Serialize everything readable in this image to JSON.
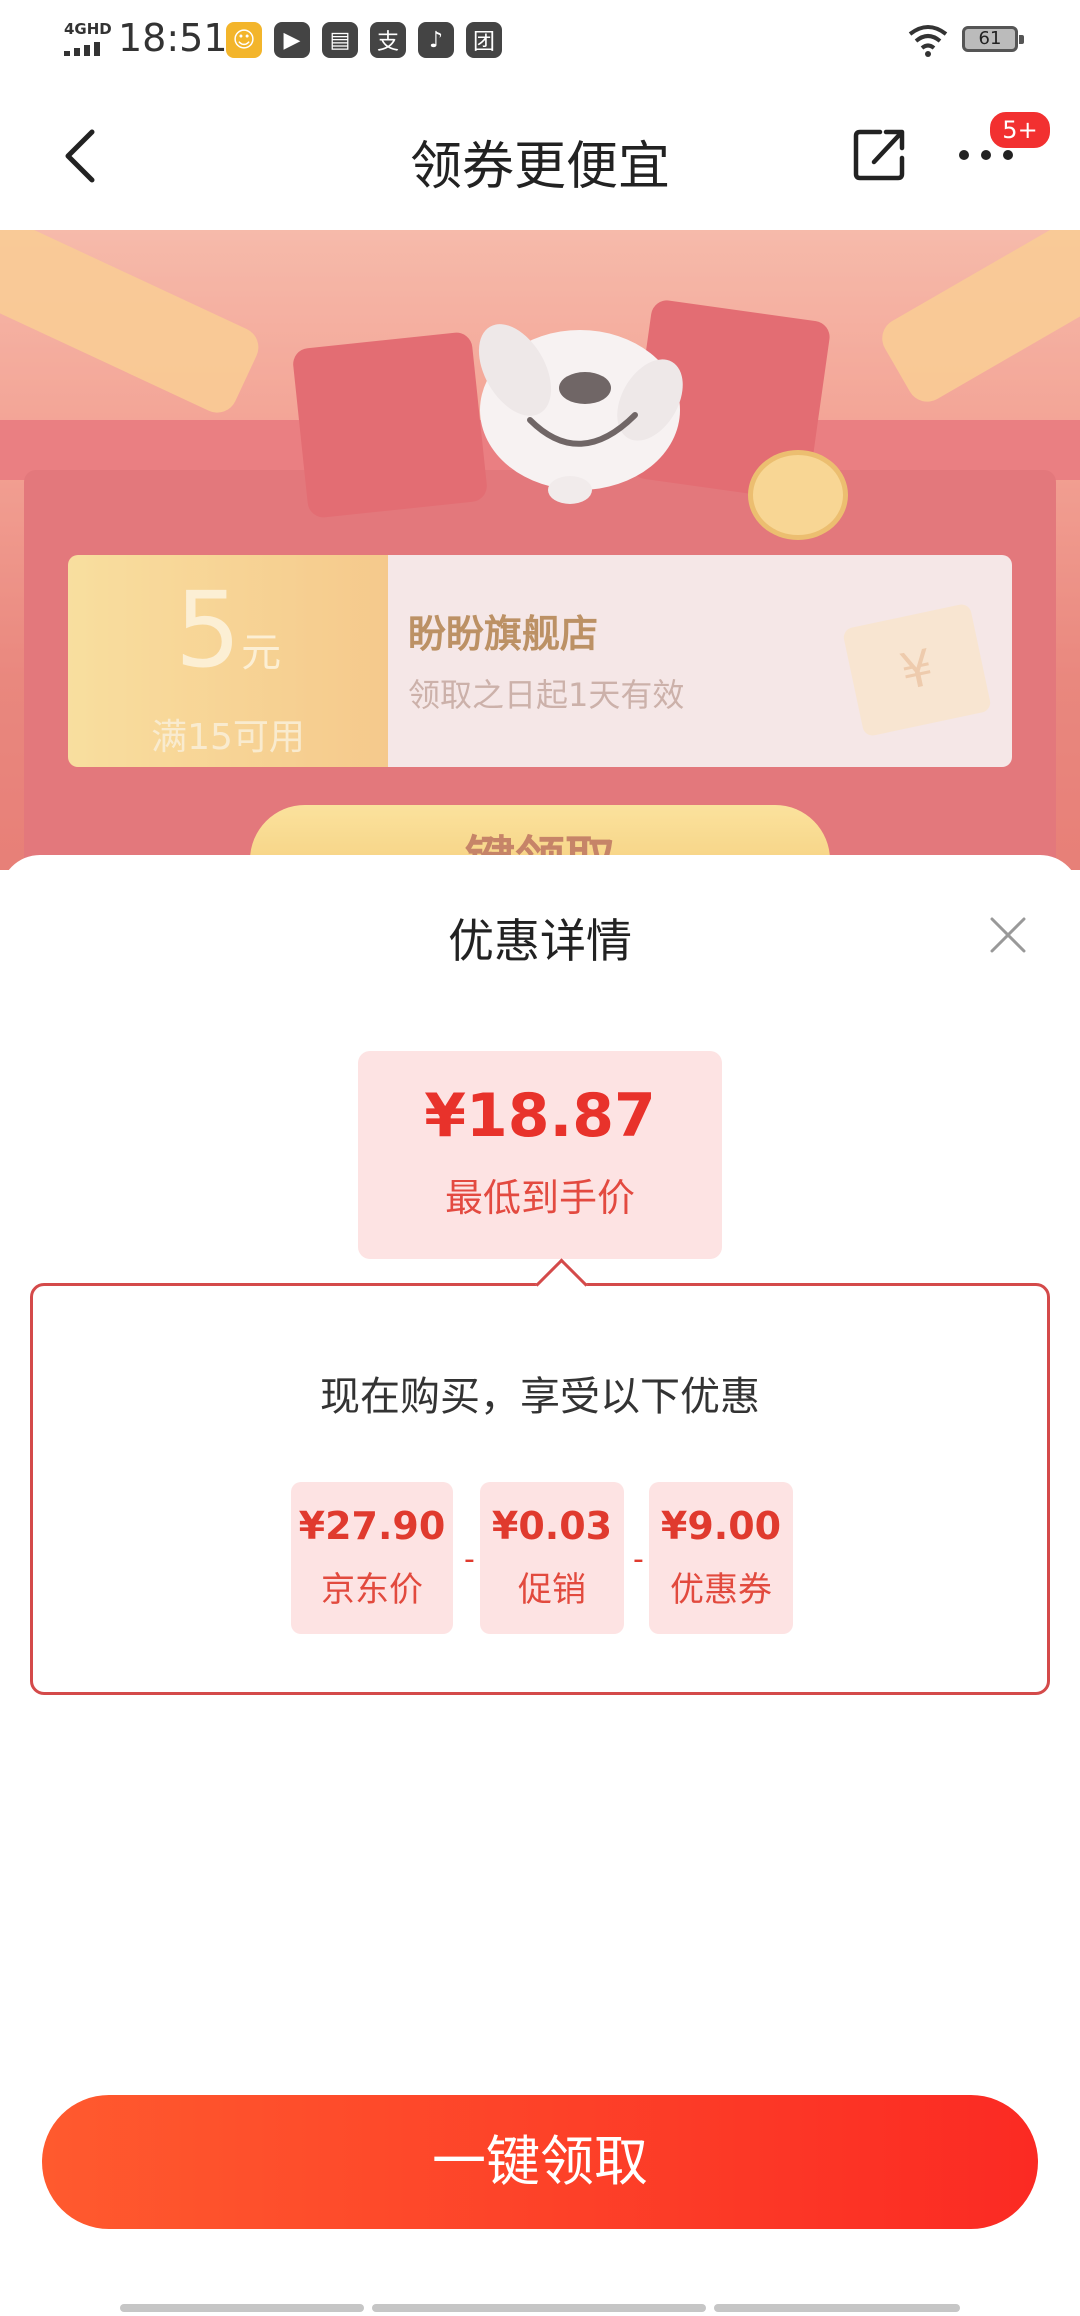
{
  "status_bar": {
    "network": "4GHD",
    "time": "18:51",
    "battery": "61"
  },
  "nav": {
    "title": "领券更便宜",
    "more_badge": "5+"
  },
  "banner": {
    "coupon_amount": "5",
    "coupon_unit": "元",
    "coupon_condition": "满15可用",
    "shop_name": "盼盼旗舰店",
    "validity": "领取之日起1天有效",
    "button_label": "键领取"
  },
  "sheet": {
    "title": "优惠详情",
    "final_price": "¥18.87",
    "final_price_label": "最低到手价",
    "detail_title": "现在购买，享受以下优惠",
    "breakdown": [
      {
        "value": "¥27.90",
        "label": "京东价"
      },
      {
        "value": "¥0.03",
        "label": "促销"
      },
      {
        "value": "¥9.00",
        "label": "优惠券"
      }
    ],
    "separator": "-",
    "cta_label": "一键领取"
  },
  "colors": {
    "accent": "#e8322b",
    "chip_bg": "#fde3e3",
    "cta_start": "#ff5a2e",
    "cta_end": "#fb2a23"
  }
}
